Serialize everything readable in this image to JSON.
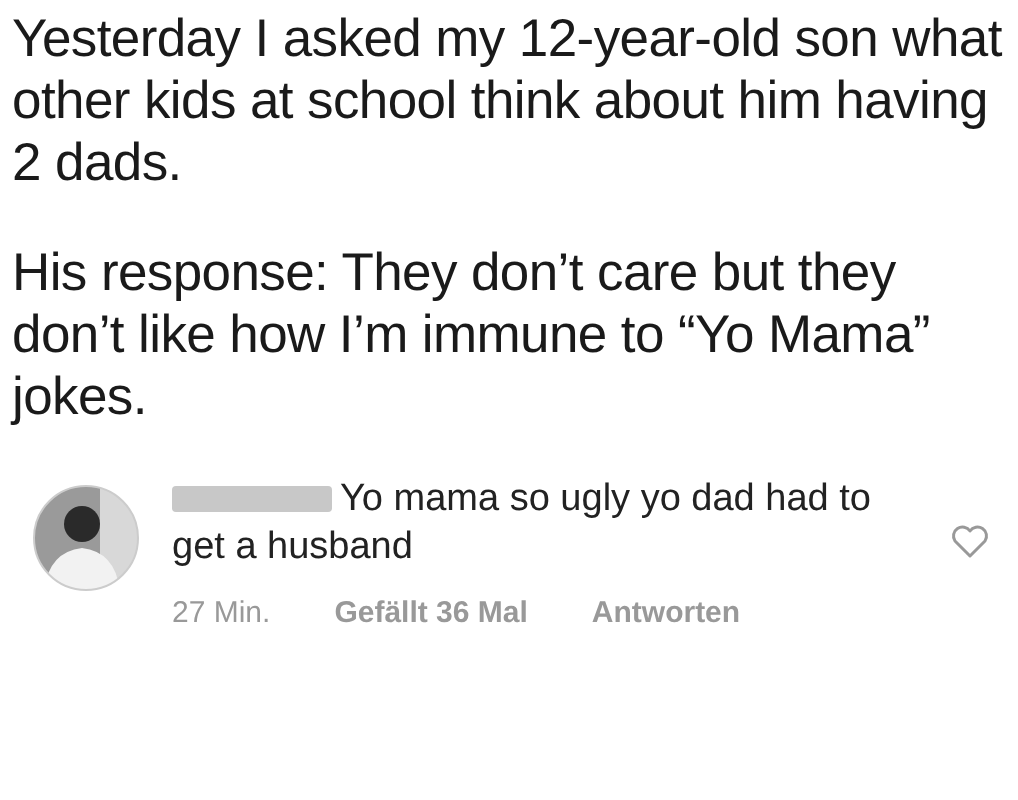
{
  "post": {
    "paragraphs": [
      "Yesterday I asked my 12-year-old son what other kids at school think about him having 2 dads.",
      "His response: They don’t care but they don’t like how I’m immune to “Yo Mama” jokes."
    ]
  },
  "comment": {
    "author_redacted": true,
    "text": "Yo mama so ugly yo dad had to get a husband",
    "time": "27 Min.",
    "likes": "Gefällt 36 Mal",
    "reply": "Antworten",
    "liked": false
  }
}
